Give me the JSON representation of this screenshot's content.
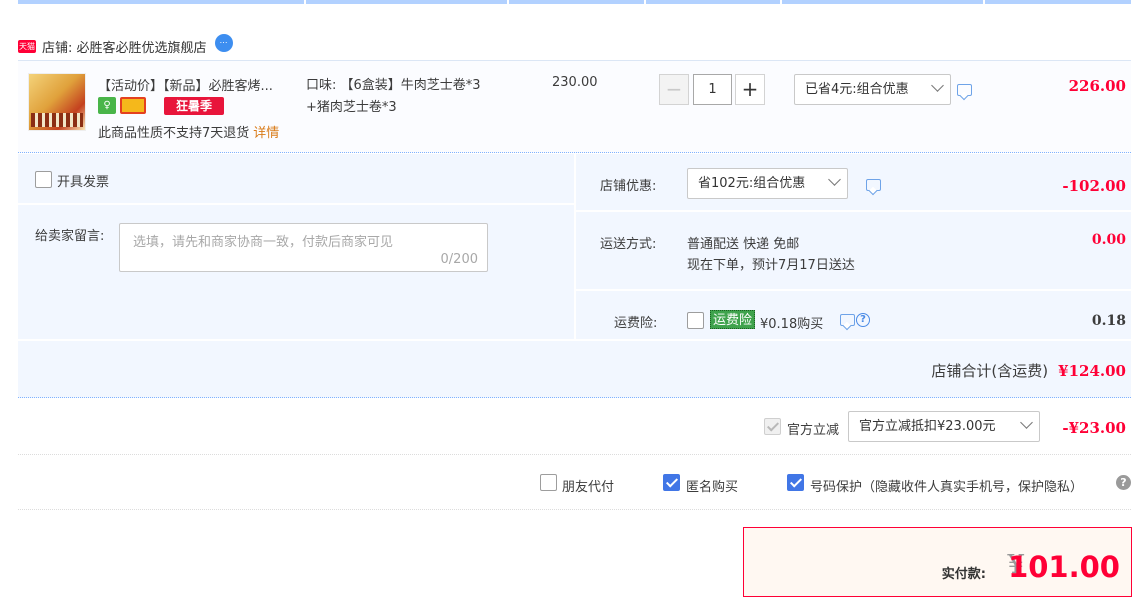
{
  "shop": {
    "badge": "天猫",
    "label": "店铺: 必胜客必胜优选旗舰店",
    "chat_icon": "wangwang-chat-icon"
  },
  "item": {
    "title": "【活动价】【新品】必胜客烤...",
    "promo_tag": "狂暑季",
    "no_return": "此商品性质不支持7天退货",
    "detail_link": "详情",
    "sku_line1": "口味: 【6盒装】牛肉芝士卷*3",
    "sku_line2": "+猪肉芝士卷*3",
    "unit_price": "230.00",
    "quantity": "1",
    "qty_minus": "−",
    "qty_plus": "+",
    "discount_select": "已省4元:组合优惠",
    "subtotal": "226.00"
  },
  "invoice": {
    "label": "开具发票",
    "checked": false
  },
  "memo": {
    "label": "给卖家留言:",
    "placeholder": "选填，请先和商家协商一致，付款后商家可见",
    "count": "0/200"
  },
  "shop_discount": {
    "label": "店铺优惠:",
    "select": "省102元:组合优惠",
    "amount": "-102.00"
  },
  "shipping": {
    "label": "运送方式:",
    "method": "普通配送 快递 免邮",
    "eta": "现在下单，预计7月17日送达",
    "amount": "0.00"
  },
  "insurance": {
    "label": "运费险:",
    "badge": "运费险",
    "text": "¥0.18购买",
    "amount": "0.18"
  },
  "shop_total": {
    "label": "店铺合计(含运费)",
    "amount": "¥124.00"
  },
  "official": {
    "label": "官方立减",
    "select": "官方立减抵扣¥23.00元",
    "amount": "-¥23.00"
  },
  "pay_options": {
    "friend_pay": "朋友代付",
    "anonymous": "匿名购买",
    "number_protect": "号码保护（隐藏收件人真实手机号，保护隐私）",
    "help": "?"
  },
  "total": {
    "label": "实付款:",
    "yen": "¥",
    "amount": "101.00"
  },
  "colors": {
    "accent_red": "#ff0036",
    "panel_blue": "#f2f7ff",
    "checkbox_blue": "#4176e6",
    "insurance_green": "#3fa34d"
  }
}
